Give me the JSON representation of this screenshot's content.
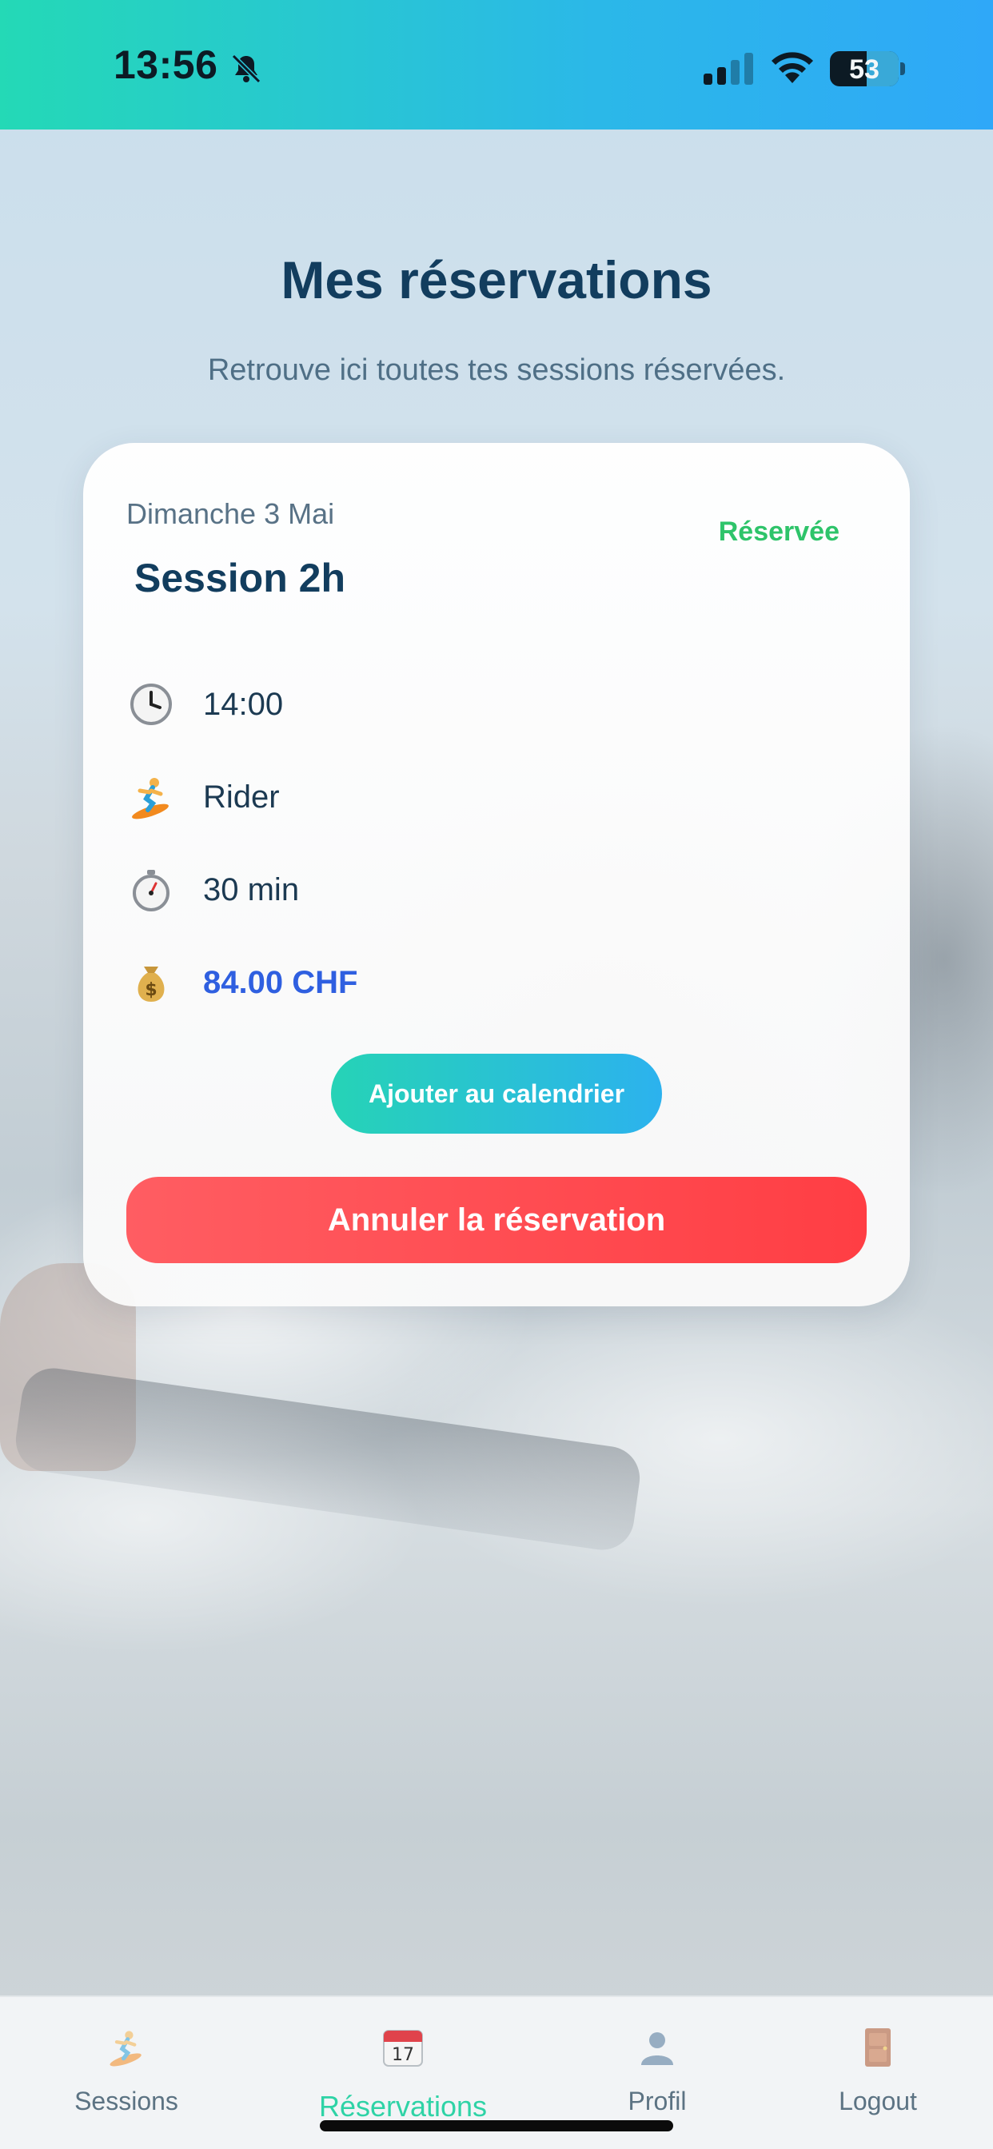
{
  "status_bar": {
    "time": "13:56",
    "battery": "53"
  },
  "header": {
    "title": "Mes réservations",
    "subtitle": "Retrouve ici toutes tes sessions réservées."
  },
  "reservation": {
    "date": "Dimanche 3 Mai",
    "status": "Réservée",
    "title": "Session 2h",
    "time": "14:00",
    "level": "Rider",
    "duration": "30 min",
    "price": "84.00 CHF",
    "calendar_button": "Ajouter au calendrier",
    "cancel_button": "Annuler la réservation"
  },
  "tabs": [
    {
      "label": "Sessions",
      "icon": "surfer-icon"
    },
    {
      "label": "Réservations",
      "icon": "calendar-icon",
      "active": true
    },
    {
      "label": "Profil",
      "icon": "user-icon"
    },
    {
      "label": "Logout",
      "icon": "door-icon"
    }
  ],
  "colors": {
    "accent_teal": "#26d3b6",
    "accent_blue": "#2fa8f8",
    "title": "#123d5e",
    "status_green": "#2ec46a",
    "price_blue": "#2f5fe0",
    "cancel_red": "#ff4a50",
    "active_tab": "#2ed3a6"
  }
}
